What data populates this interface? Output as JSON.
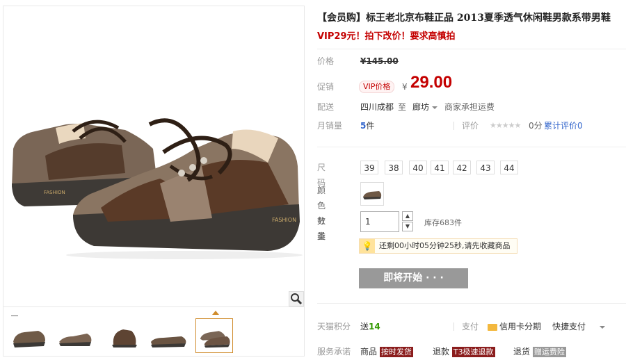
{
  "product": {
    "title": "【会员购】标王老北京布鞋正品 2013夏季透气休闲鞋男款系带男鞋",
    "subtitle": "VIP29元！拍下改价！要求高慎拍",
    "gallery": {
      "thumbnails": [
        "thumb-1",
        "thumb-2",
        "thumb-3",
        "thumb-4",
        "thumb-5"
      ],
      "active_index": 4,
      "brand_text": "FASHION"
    }
  },
  "price": {
    "label": "价格",
    "currency": "¥",
    "original": "145.00",
    "promo_label": "促销",
    "vip_tag": "VIP价格",
    "vip_price": "29.00"
  },
  "shipping": {
    "label": "配送",
    "from": "四川成都",
    "to_word": "至",
    "to": "廊坊",
    "fee": "商家承担运费"
  },
  "sales": {
    "monthly_label": "月销量",
    "monthly_value": "5",
    "monthly_unit": "件",
    "rating_label": "评价",
    "stars": "★★★★★",
    "score": "0分",
    "total_reviews": "累计评价0"
  },
  "options": {
    "size_label": "尺码",
    "sizes": [
      "39",
      "38",
      "40",
      "41",
      "42",
      "43",
      "44"
    ],
    "color_label": "颜色分类",
    "qty_label": "数量",
    "qty_value": "1",
    "stock": "库存683件"
  },
  "tip": {
    "text": "还剩00小时05分钟25秒,请先收藏商品"
  },
  "cta": {
    "start_label": "即将开始 · · ·"
  },
  "footer": {
    "points_label": "天猫积分",
    "points_prefix": "送",
    "points_value": "14",
    "pay_label": "支付",
    "credit_installment": "信用卡分期",
    "quick_pay": "快捷支付",
    "service_label": "服务承诺",
    "service_item1_prefix": "商品",
    "service_item1_tag": "按时发货",
    "service_item2_prefix": "退款",
    "service_item2_tag": "T3极速退款",
    "service_item3_prefix": "退货",
    "service_item3_tag": "赠运费险"
  }
}
